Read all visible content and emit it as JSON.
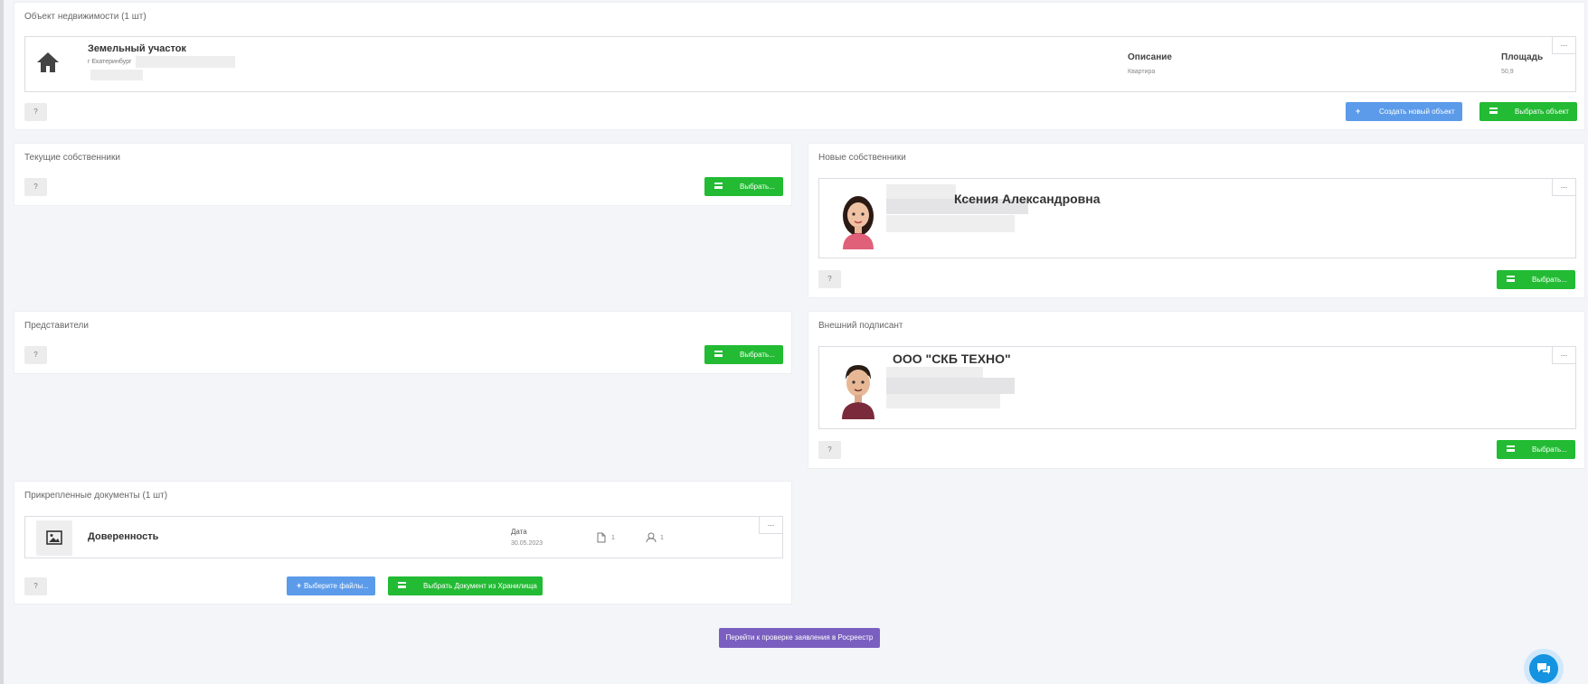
{
  "property": {
    "title": "Объект недвижимости (1 шт)",
    "name": "Земельный участок",
    "address": "г Екатеринбург",
    "description_label": "Описание",
    "description_value": "Квартира",
    "area_label": "Площадь",
    "area_value": "50,9",
    "create_button": "Создать новый объект",
    "select_button": "Выбрать объект"
  },
  "current_owners": {
    "title": "Текущие собственники",
    "select_button": "Выбрать..."
  },
  "new_owners": {
    "title": "Новые собственники",
    "person_name": "Ксения Александровна",
    "select_button": "Выбрать..."
  },
  "representatives": {
    "title": "Представители",
    "select_button": "Выбрать..."
  },
  "external_signer": {
    "title": "Внешний подписант",
    "org_name": "ООО \"СКБ ТЕХНО\"",
    "select_button": "Выбрать..."
  },
  "documents": {
    "title": "Прикрепленные документы (1 шт)",
    "doc_name": "Доверенность",
    "date_label": "Дата",
    "date_value": "30.05.2023",
    "files_count": "1",
    "signers_count": "1",
    "choose_files_button": "Выберите файлы...",
    "choose_from_storage_button": "Выбрать Документ из Хранилища"
  },
  "common": {
    "help": "?",
    "more": "...",
    "plus": "+"
  },
  "footer": {
    "proceed_button": "Перейти к проверке заявления в Росреестр"
  },
  "icons": {
    "home": "home-icon",
    "image": "image-icon",
    "file": "file-icon",
    "signer": "user-icon",
    "list": "list-icon",
    "chat": "chat-icon"
  },
  "colors": {
    "green": "#22bb33",
    "blue": "#5b9bea",
    "purple": "#7b5fc0",
    "chat": "#1493e0"
  }
}
